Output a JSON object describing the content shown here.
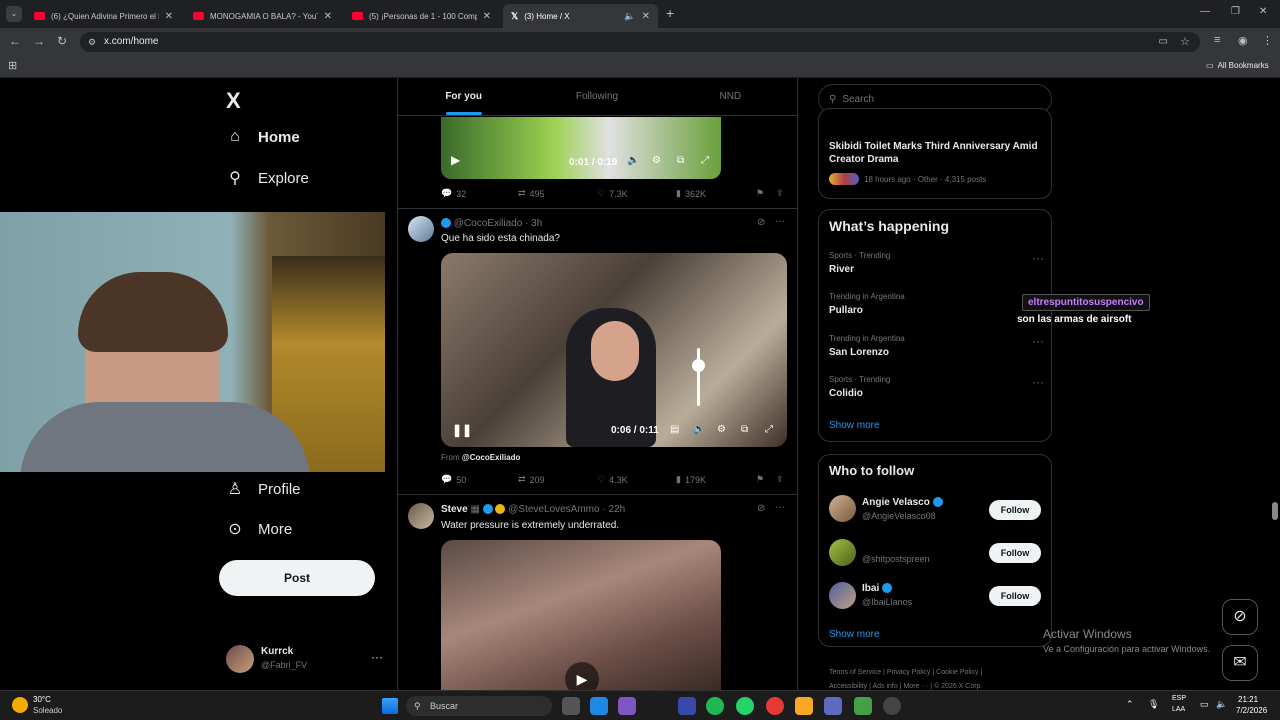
{
  "browser": {
    "tabs": [
      {
        "title": "(6) ¿Quien Adivina Primero el P"
      },
      {
        "title": "MONOGAMIA O BALA? - YouTu"
      },
      {
        "title": "(5) ¡Personas de 1 - 100 Comp"
      },
      {
        "title": "(3) Home / X"
      }
    ],
    "new_tab": "+",
    "url": "x.com/home",
    "bookmarks_label": "All Bookmarks"
  },
  "sidebar": {
    "logo": "X",
    "items": [
      {
        "label": "Home",
        "icon": "home-icon"
      },
      {
        "label": "Explore",
        "icon": "search-icon"
      },
      {
        "label": "Profile",
        "icon": "person-icon"
      },
      {
        "label": "More",
        "icon": "more-circle-icon"
      }
    ],
    "post_button": "Post",
    "account": {
      "name": "Kurrck",
      "handle": "@Fabri_FV"
    }
  },
  "feed": {
    "tabs": [
      "For you",
      "Following",
      "NND"
    ],
    "post1": {
      "video_time": "0:01 / 0:19",
      "metrics": {
        "replies": "32",
        "reposts": "495",
        "likes": "7.3K",
        "views": "362K"
      }
    },
    "post2": {
      "handle": "@CocoExiliado",
      "time": "· 3h",
      "text": "Que ha sido esta chinada?",
      "video_time": "0:06 / 0:11",
      "from_label": "From",
      "from_handle": "@CocoExiliado",
      "metrics": {
        "replies": "50",
        "reposts": "209",
        "likes": "4.3K",
        "views": "179K"
      }
    },
    "post3": {
      "name": "Steve",
      "handle": "@SteveLovesAmmo",
      "time": "· 22h",
      "text": "Water pressure is extremely underrated."
    }
  },
  "right": {
    "search_placeholder": "Search",
    "news": {
      "title": "Skibidi Toilet Marks Third Anniversary Amid Creator Drama",
      "meta": "18 hours ago · Other · 4,315 posts"
    },
    "happening": {
      "title": "What’s happening",
      "trends": [
        {
          "meta": "Sports · Trending",
          "name": "River"
        },
        {
          "meta": "Trending in Argentina",
          "name": "Pullaro"
        },
        {
          "meta": "Trending in Argentina",
          "name": "San Lorenzo"
        },
        {
          "meta": "Sports · Trending",
          "name": "Colidio"
        }
      ],
      "show_more": "Show more"
    },
    "who_to_follow": {
      "title": "Who to follow",
      "people": [
        {
          "name": "Angie Velasco",
          "handle": "@AngieVelasco08",
          "button": "Follow"
        },
        {
          "name": "",
          "handle": "@shitpostspreen",
          "button": "Follow"
        },
        {
          "name": "Ibai",
          "handle": "@IbaiLlanos",
          "button": "Follow"
        }
      ],
      "show_more": "Show more"
    },
    "footer": {
      "line1": [
        "Terms of Service",
        "Privacy Policy",
        "Cookie Policy"
      ],
      "line2": [
        "Accessibility",
        "Ads info",
        "More ···",
        "© 2026 X Corp."
      ]
    }
  },
  "overlay": {
    "chat_user": "eltrespuntitosuspencivo",
    "chat_message": "son las armas de airsoft",
    "activate_title": "Activar Windows",
    "activate_sub": "Ve a Configuración para activar Windows."
  },
  "taskbar": {
    "weather_temp": "30°C",
    "weather_desc": "Soleado",
    "search_placeholder": "Buscar",
    "lang": "ESP",
    "lang2": "LAA",
    "time": "21:21",
    "date": "7/2/2026"
  }
}
